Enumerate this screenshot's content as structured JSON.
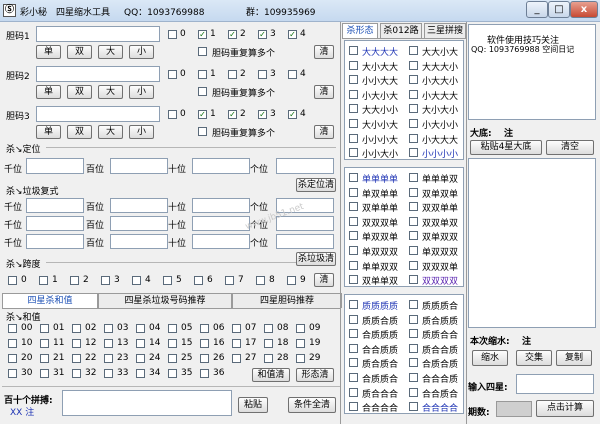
{
  "window": {
    "title": "彩小秘",
    "subtitle": "四星缩水工具",
    "qq": "QQ：1093769988",
    "group": "群：109935969",
    "min": "_",
    "max": "□",
    "close": "x"
  },
  "bills": [
    {
      "label": "胆码1",
      "dbl": "胆码重复算多个",
      "btns": [
        "单",
        "双",
        "大",
        "小"
      ],
      "clear": "清",
      "checks": [
        {
          "l": "0",
          "c": false
        },
        {
          "l": "1",
          "c": true
        },
        {
          "l": "2",
          "c": true
        },
        {
          "l": "3",
          "c": true
        },
        {
          "l": "4",
          "c": true
        }
      ]
    },
    {
      "label": "胆码2",
      "dbl": "胆码重复算多个",
      "btns": [
        "单",
        "双",
        "大",
        "小"
      ],
      "clear": "清",
      "checks": [
        {
          "l": "0",
          "c": false
        },
        {
          "l": "1",
          "c": false
        },
        {
          "l": "2",
          "c": false
        },
        {
          "l": "3",
          "c": false
        },
        {
          "l": "4",
          "c": false
        }
      ]
    },
    {
      "label": "胆码3",
      "dbl": "胆码重复算多个",
      "btns": [
        "单",
        "双",
        "大",
        "小"
      ],
      "clear": "清",
      "checks": [
        {
          "l": "0",
          "c": false
        },
        {
          "l": "1",
          "c": true
        },
        {
          "l": "2",
          "c": true
        },
        {
          "l": "3",
          "c": true
        },
        {
          "l": "4",
          "c": true
        }
      ]
    }
  ],
  "position": {
    "title": "杀↘定位",
    "labels": [
      "千位",
      "百位",
      "十位",
      "个位"
    ],
    "kill": "杀定位清"
  },
  "junk": {
    "title": "杀↘垃圾复式",
    "labels": [
      "千位",
      "百位",
      "十位",
      "个位"
    ],
    "kill": "杀垃圾清"
  },
  "span": {
    "title": "杀↘跨度",
    "digits": [
      "0",
      "1",
      "2",
      "3",
      "4",
      "5",
      "6",
      "7",
      "8",
      "9"
    ],
    "clear": "清"
  },
  "bottomTabs": [
    "四星杀和值",
    "四星杀垃圾号码推荐",
    "四星胆码推荐"
  ],
  "sum": {
    "title": "杀↘和值",
    "nums": [
      "00",
      "01",
      "02",
      "03",
      "04",
      "05",
      "06",
      "07",
      "08",
      "09",
      "10",
      "11",
      "12",
      "13",
      "14",
      "15",
      "16",
      "17",
      "18",
      "19",
      "20",
      "21",
      "22",
      "23",
      "24",
      "25",
      "26",
      "27",
      "28",
      "29",
      "30",
      "31",
      "32",
      "33",
      "34",
      "35",
      "36"
    ],
    "clear": "和值清",
    "formClear": "形态清"
  },
  "pin": {
    "title": "百十个拼搏:",
    "value": "XX 注",
    "paste": "粘贴",
    "allClear": "条件全清"
  },
  "midTabs": [
    "杀形态",
    "杀012路",
    "三星拼搜"
  ],
  "forms1": [
    {
      "l": "大大大大",
      "c": "blue"
    },
    {
      "l": "大大小大",
      "c": ""
    },
    {
      "l": "大小大大",
      "c": ""
    },
    {
      "l": "大大大小",
      "c": ""
    },
    {
      "l": "小小大大",
      "c": ""
    },
    {
      "l": "小大大小",
      "c": ""
    },
    {
      "l": "小大小大",
      "c": ""
    },
    {
      "l": "小大大大",
      "c": ""
    },
    {
      "l": "大大小小",
      "c": ""
    },
    {
      "l": "大小大小",
      "c": ""
    },
    {
      "l": "大小小大",
      "c": ""
    },
    {
      "l": "小大小小",
      "c": ""
    },
    {
      "l": "小小小大",
      "c": ""
    },
    {
      "l": "小大大大",
      "c": ""
    },
    {
      "l": "小小大小",
      "c": ""
    },
    {
      "l": "小小小小",
      "c": "blue"
    }
  ],
  "forms2": [
    {
      "l": "单单单单",
      "c": "blue"
    },
    {
      "l": "单单单双",
      "c": ""
    },
    {
      "l": "单双单单",
      "c": ""
    },
    {
      "l": "双单双单",
      "c": ""
    },
    {
      "l": "双单单单",
      "c": ""
    },
    {
      "l": "双双单单",
      "c": ""
    },
    {
      "l": "双双双单",
      "c": ""
    },
    {
      "l": "双双单双",
      "c": ""
    },
    {
      "l": "单双双单",
      "c": ""
    },
    {
      "l": "双单双双",
      "c": ""
    },
    {
      "l": "单双双双",
      "c": ""
    },
    {
      "l": "单双双双",
      "c": ""
    },
    {
      "l": "单单双双",
      "c": ""
    },
    {
      "l": "双双双单",
      "c": ""
    },
    {
      "l": "双单单双",
      "c": ""
    },
    {
      "l": "双双双双",
      "c": "purple"
    }
  ],
  "forms3": [
    {
      "l": "质质质质",
      "c": "blue"
    },
    {
      "l": "质质质合",
      "c": ""
    },
    {
      "l": "质质合质",
      "c": ""
    },
    {
      "l": "质合质质",
      "c": ""
    },
    {
      "l": "合质质质",
      "c": ""
    },
    {
      "l": "质质合合",
      "c": ""
    },
    {
      "l": "合合质质",
      "c": ""
    },
    {
      "l": "质合合质",
      "c": ""
    },
    {
      "l": "质合质合",
      "c": ""
    },
    {
      "l": "合质合质",
      "c": ""
    },
    {
      "l": "合质质合",
      "c": ""
    },
    {
      "l": "合合合质",
      "c": ""
    },
    {
      "l": "质合合合",
      "c": ""
    },
    {
      "l": "合合质合",
      "c": ""
    },
    {
      "l": "合合合合",
      "c": ""
    },
    {
      "l": "合合合合",
      "c": "blue"
    }
  ],
  "info": {
    "line1": "软件使用技巧关注",
    "line2": "QQ: 1093769988  空间日记"
  },
  "base": {
    "label": "大底:",
    "value": "注",
    "paste": "粘贴4星大底",
    "clear": "清空"
  },
  "shrink": {
    "label": "本次缩水:",
    "value": "注",
    "btns": [
      "缩水",
      "交集",
      "复制"
    ]
  },
  "input4": {
    "label": "输入四星:"
  },
  "period": {
    "label": "期数:",
    "calc": "点击计算"
  },
  "watermark": "www.jb51.net"
}
